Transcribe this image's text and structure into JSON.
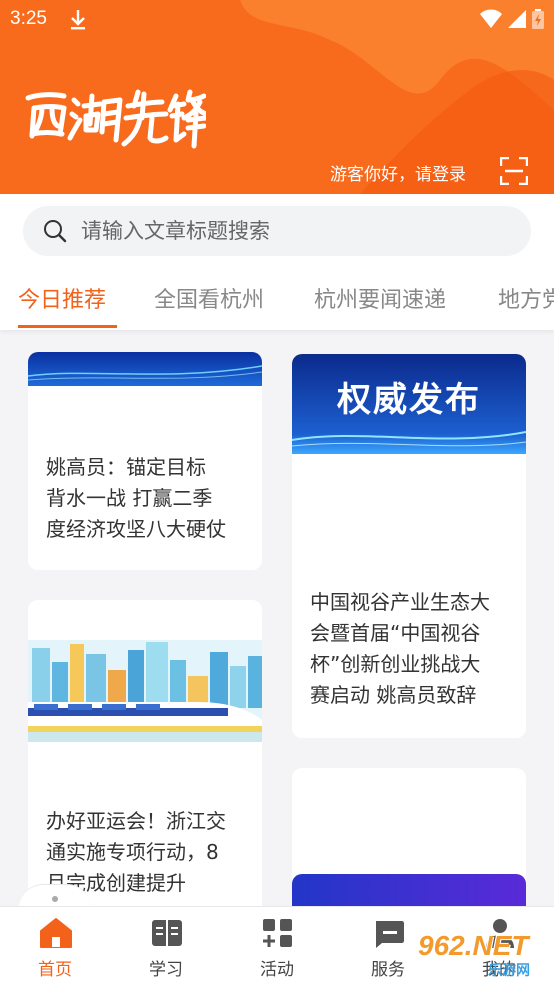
{
  "status_bar": {
    "time": "3:25"
  },
  "header": {
    "brand_logo_text": "西湖先锋",
    "login_prompt": "游客你好，请登录",
    "accent_color": "#f86a1c"
  },
  "search": {
    "placeholder": "请输入文章标题搜索"
  },
  "tabs": [
    {
      "label": "今日推荐",
      "active": true
    },
    {
      "label": "全国看杭州",
      "active": false
    },
    {
      "label": "杭州要闻速递",
      "active": false
    },
    {
      "label": "地方党",
      "active": false
    }
  ],
  "cards": {
    "card1": {
      "line1": "姚高员：锚定目标",
      "line2": "背水一战 打赢二季",
      "line3": "度经济攻坚八大硬仗"
    },
    "card2": {
      "banner_text": "权威发布",
      "line1": "中国视谷产业生态大",
      "line2": "会暨首届“中国视谷",
      "line3": "杯”创新创业挑战大",
      "line4": "赛启动 姚高员致辞"
    },
    "card3": {
      "line1": "办好亚运会！浙江交",
      "line2": "通实施专项行动，8",
      "line3": "月完成创建提升"
    }
  },
  "bottom_nav": [
    {
      "label": "首页",
      "icon": "home-icon",
      "active": true
    },
    {
      "label": "学习",
      "icon": "book-icon",
      "active": false
    },
    {
      "label": "活动",
      "icon": "grid-plus-icon",
      "active": false
    },
    {
      "label": "服务",
      "icon": "chat-icon",
      "active": false
    },
    {
      "label": "我的",
      "icon": "person-icon",
      "active": false
    }
  ],
  "watermark": {
    "text": "962.NET",
    "subtext": "乐游网"
  }
}
